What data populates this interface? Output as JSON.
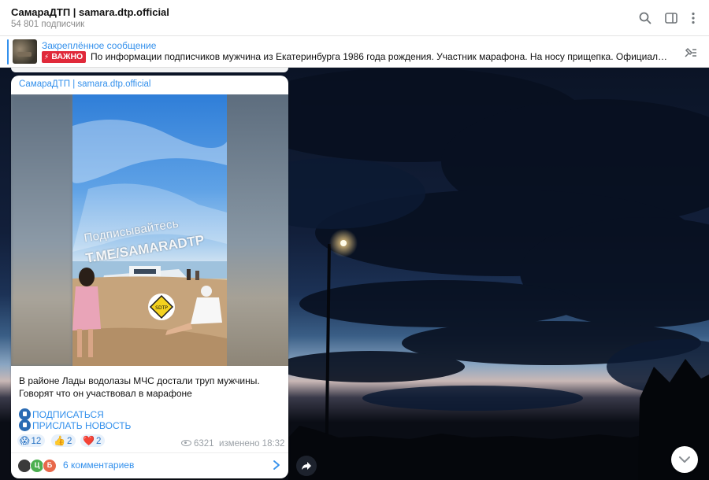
{
  "header": {
    "title": "СамараДТП | samara.dtp.official",
    "subscribers": "54 801 подписчик",
    "icons": [
      "search-icon",
      "sidebar-toggle-icon",
      "more-vertical-icon"
    ]
  },
  "pinned": {
    "label": "Закреплённое сообщение",
    "badge": "ВАЖНО",
    "text": "По информации подписчиков мужчина из Екатеринбурга 1986 года рождения. Участник марафона. На носу прищепка.   Официальной инфо..."
  },
  "message": {
    "channel": "СамараДТП | samara.dtp.official",
    "watermark_line1": "Подписывайтесь",
    "watermark_line2": "T.ME/SAMARADTP",
    "caption": "В районе Лады водолазы МЧС достали труп мужчины. Говорят что он участвовал в марафоне",
    "subscribe_link": "ПОДПИСАТЬСЯ",
    "send_news_link": "ПРИСЛАТЬ НОВОСТЬ",
    "reactions": [
      {
        "emoji": "😱",
        "count": "12"
      },
      {
        "emoji": "👍",
        "count": "2"
      },
      {
        "emoji": "❤️",
        "count": "2"
      }
    ],
    "views": "6321",
    "edited": "изменено 18:32",
    "comment_avatars": [
      {
        "letter": "",
        "color": "#3a3a3a"
      },
      {
        "letter": "Ц",
        "color": "#4caf50"
      },
      {
        "letter": "Б",
        "color": "#e8684a"
      }
    ],
    "comments": "6 комментариев"
  }
}
